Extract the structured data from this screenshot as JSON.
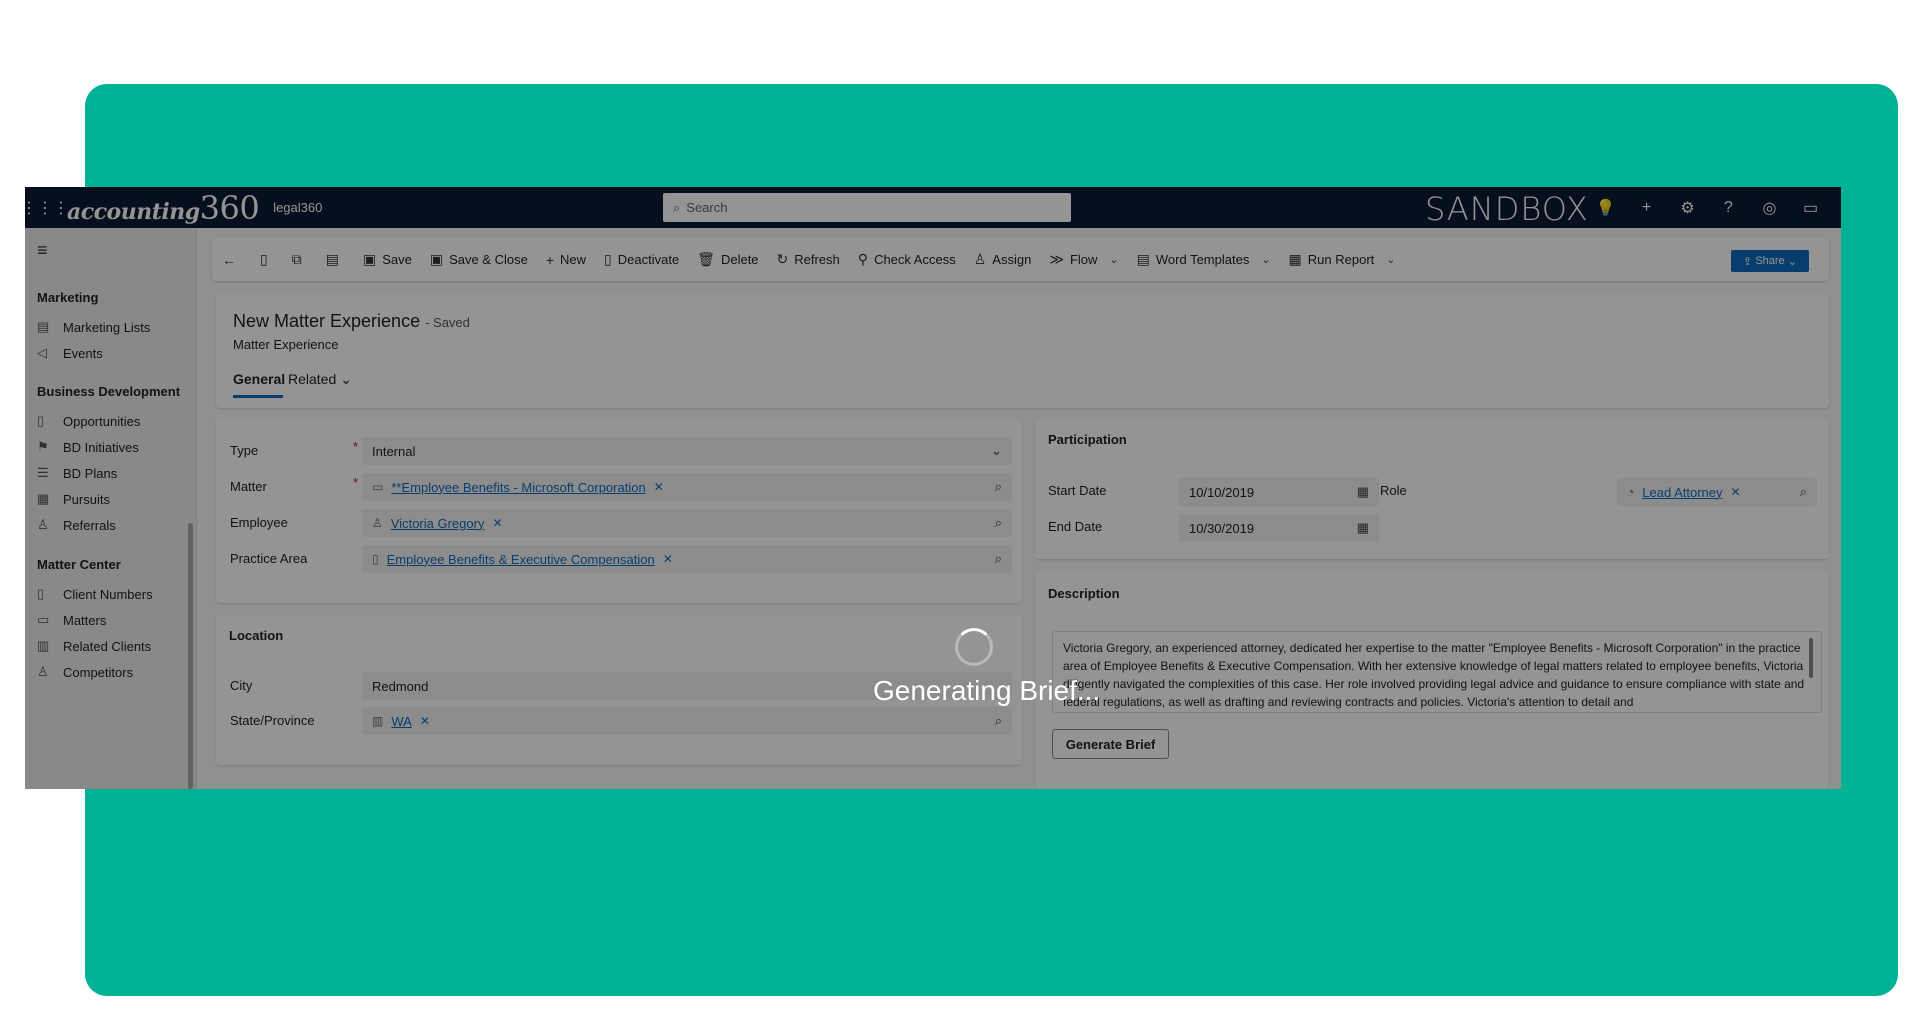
{
  "brand": {
    "logo_text": "accounting",
    "logo_num": "360",
    "app_name": "legal360",
    "environment": "SANDBOX"
  },
  "search": {
    "placeholder": "Search"
  },
  "topbar_icons": [
    "lightbulb-icon",
    "plus-icon",
    "gear-icon",
    "help-icon",
    "copilot-icon",
    "chat-icon"
  ],
  "sidebar": {
    "groups": [
      {
        "title": "Marketing",
        "items": [
          {
            "label": "Marketing Lists",
            "icon": "list-icon"
          },
          {
            "label": "Events",
            "icon": "megaphone-icon"
          }
        ]
      },
      {
        "title": "Business Development",
        "items": [
          {
            "label": "Opportunities",
            "icon": "doc-icon"
          },
          {
            "label": "BD Initiatives",
            "icon": "flag-icon"
          },
          {
            "label": "BD Plans",
            "icon": "plan-icon"
          },
          {
            "label": "Pursuits",
            "icon": "pursuit-icon"
          },
          {
            "label": "Referrals",
            "icon": "person-icon"
          }
        ]
      },
      {
        "title": "Matter Center",
        "items": [
          {
            "label": "Client Numbers",
            "icon": "doc-icon"
          },
          {
            "label": "Matters",
            "icon": "briefcase-icon"
          },
          {
            "label": "Related Clients",
            "icon": "people-icon"
          },
          {
            "label": "Competitors",
            "icon": "person-icon"
          }
        ]
      }
    ]
  },
  "commands": {
    "save": "Save",
    "save_close": "Save & Close",
    "new": "New",
    "deactivate": "Deactivate",
    "delete": "Delete",
    "refresh": "Refresh",
    "check_access": "Check Access",
    "assign": "Assign",
    "flow": "Flow",
    "word_templates": "Word Templates",
    "run_report": "Run Report",
    "share": "Share"
  },
  "header": {
    "title": "New Matter Experience",
    "saved": "- Saved",
    "entity": "Matter Experience",
    "tabs": [
      "General",
      "Related"
    ]
  },
  "general": {
    "type_label": "Type",
    "type_value": "Internal",
    "matter_label": "Matter",
    "matter_value": "**Employee Benefits - Microsoft Corporation",
    "employee_label": "Employee",
    "employee_value": "Victoria Gregory",
    "practice_label": "Practice Area",
    "practice_value": "Employee Benefits & Executive Compensation"
  },
  "location": {
    "title": "Location",
    "city_label": "City",
    "city_value": "Redmond",
    "state_label": "State/Province",
    "state_value": "WA"
  },
  "participation": {
    "title": "Participation",
    "start_label": "Start Date",
    "start_value": "10/10/2019",
    "end_label": "End Date",
    "end_value": "10/30/2019",
    "role_label": "Role",
    "role_value": "Lead Attorney"
  },
  "description": {
    "title": "Description",
    "text": "Victoria Gregory, an experienced attorney, dedicated her expertise to the matter \"Employee Benefits - Microsoft Corporation\" in the practice area of Employee Benefits & Executive Compensation. With her extensive knowledge of legal matters related to employee benefits, Victoria diligently navigated the complexities of this case. Her role involved providing legal advice and guidance to ensure compliance with state and federal regulations, as well as drafting and reviewing contracts and policies. Victoria's attention to detail and",
    "button": "Generate Brief"
  },
  "loading": {
    "text": "Generating Brief..."
  }
}
